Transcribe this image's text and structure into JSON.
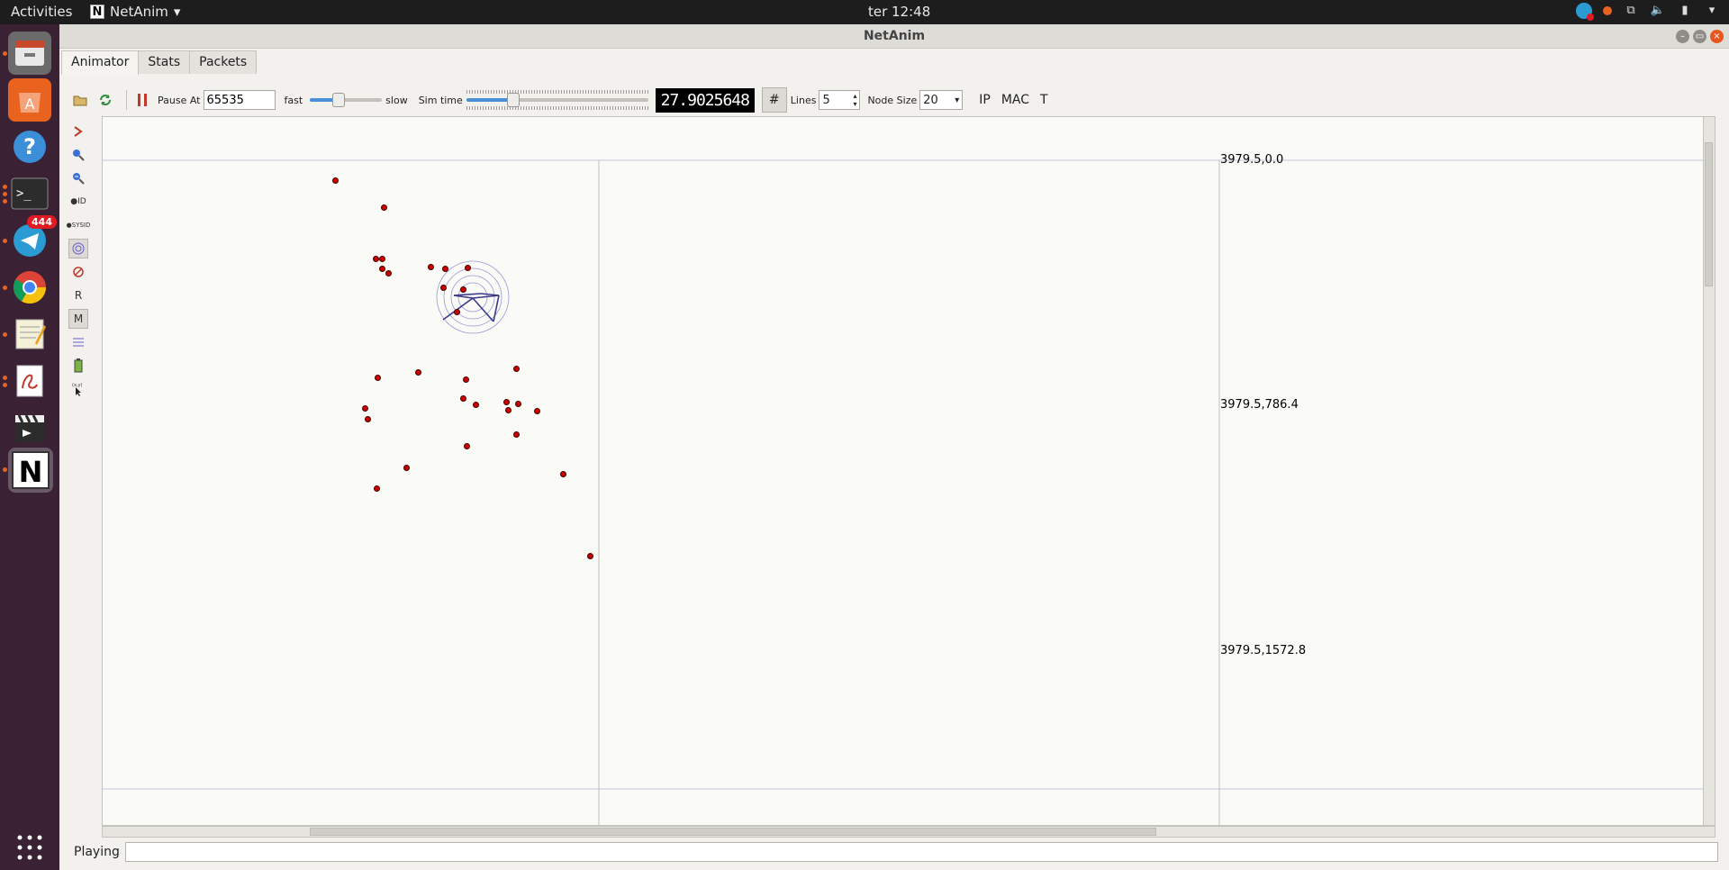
{
  "topbar": {
    "activities": "Activities",
    "app_name": "NetAnim",
    "app_icon_letter": "N",
    "clock": "ter 12:48"
  },
  "dock": {
    "apps": [
      {
        "name": "Files",
        "icon": "files-icon"
      },
      {
        "name": "Ubuntu Software",
        "icon": "software-center-icon"
      },
      {
        "name": "Help",
        "icon": "help-icon"
      },
      {
        "name": "Terminal",
        "icon": "terminal-icon"
      },
      {
        "name": "Telegram",
        "icon": "telegram-icon",
        "badge": "444"
      },
      {
        "name": "Chrome",
        "icon": "chrome-icon"
      },
      {
        "name": "Text Editor",
        "icon": "text-editor-icon"
      },
      {
        "name": "Document Viewer",
        "icon": "document-viewer-icon"
      },
      {
        "name": "Video Editor",
        "icon": "clapperboard-icon"
      },
      {
        "name": "NetAnim",
        "icon": "netanim-icon",
        "letter": "N"
      }
    ],
    "show_apps_icon": "app-grid-icon"
  },
  "window": {
    "title": "NetAnim"
  },
  "tabs": [
    {
      "label": "Animator",
      "active": true
    },
    {
      "label": "Stats",
      "active": false
    },
    {
      "label": "Packets",
      "active": false
    }
  ],
  "toolbar": {
    "pause_at_label": "Pause At",
    "pause_at_value": "65535",
    "fast_label": "fast",
    "slow_label": "slow",
    "speed_fraction": 0.4,
    "sim_time_label": "Sim time",
    "sim_time_fraction": 0.26,
    "sim_time_value": "27.9025648",
    "lines_label": "Lines",
    "lines_value": "5",
    "node_size_label": "Node Size",
    "node_size_value": "20",
    "ip_label": "IP",
    "mac_label": "MAC",
    "t_label": "T"
  },
  "sidetools": {
    "r_label": "R",
    "m_label": "M"
  },
  "canvas": {
    "coord_labels": [
      "3979.5,0.0",
      "3979.5,786.4",
      "3979.5,1572.8"
    ],
    "node_color": "#cc0000"
  },
  "status": {
    "label": "Playing",
    "value": ""
  }
}
